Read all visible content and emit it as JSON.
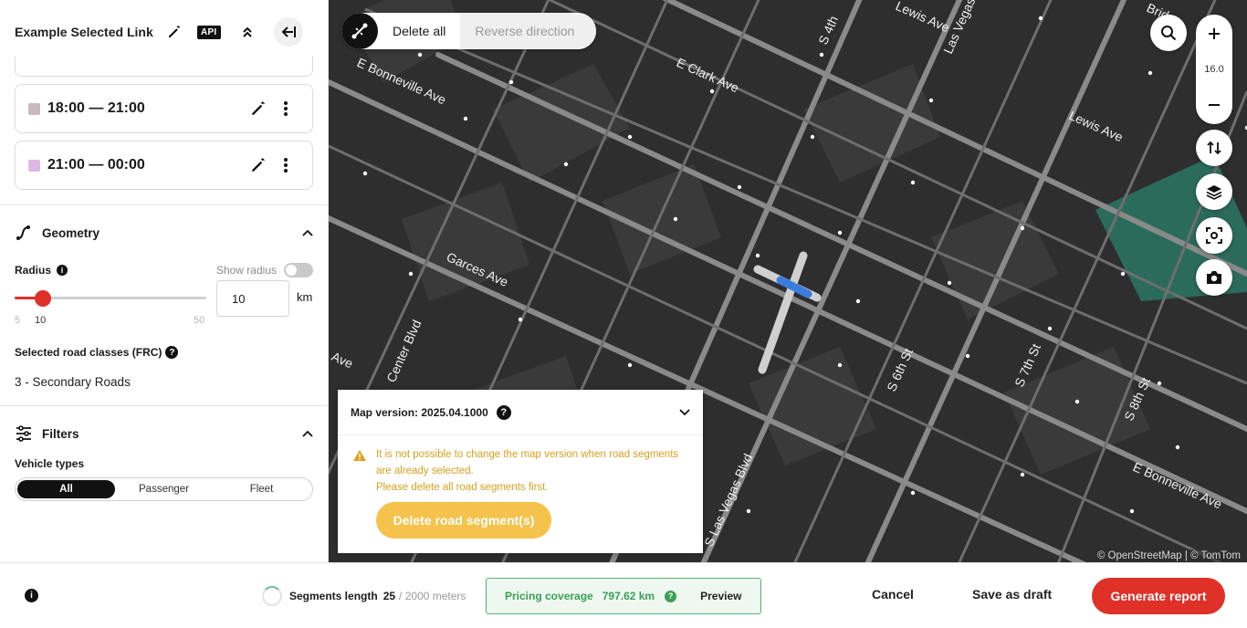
{
  "sidebar": {
    "title": "Example Selected Link",
    "api_label": "API",
    "time_slots": [
      {
        "label": "18:00 — 21:00",
        "color": "#c9b9bd"
      },
      {
        "label": "21:00 — 00:00",
        "color": "#ddb8e6"
      }
    ],
    "geometry": {
      "title": "Geometry",
      "radius_label": "Radius",
      "show_radius_label": "Show radius",
      "show_radius_on": false,
      "slider_min": "5",
      "slider_value": "10",
      "slider_max": "50",
      "radius_input": "10",
      "unit": "km",
      "road_classes_label": "Selected road classes (FRC)",
      "road_classes_value": "3 - Secondary Roads"
    },
    "filters": {
      "title": "Filters",
      "vehicle_types_label": "Vehicle types",
      "options": [
        "All",
        "Passenger",
        "Fleet"
      ],
      "selected": "All"
    }
  },
  "map": {
    "toolbar": {
      "delete_all": "Delete all",
      "reverse_direction": "Reverse direction"
    },
    "zoom_level": "16.0",
    "street_labels": [
      "E Bonneville Ave",
      "E Clark Ave",
      "Lewis Ave",
      "Lewis Ave",
      "Las Vegas",
      "S 4th",
      "Garces Ave",
      "Center Blvd",
      "Ave",
      "S 6th St",
      "S 7th St",
      "S 8th St",
      "E Bonneville Ave",
      "S Las Vegas Blvd",
      "Bridge"
    ],
    "attribution": "© OpenStreetMap | © TomTom",
    "map_version": {
      "label": "Map version: 2025.04.1000",
      "warning_lines": [
        "It is not possible to change the map version when road segments",
        "are already selected.",
        "Please delete all road segments first."
      ],
      "delete_button": "Delete road segment(s)"
    }
  },
  "footer": {
    "segments_length_label": "Segments length",
    "segments_length_value": "25",
    "segments_length_max": "/ 2000 meters",
    "pricing_label": "Pricing coverage",
    "pricing_value": "797.62 km",
    "preview": "Preview",
    "cancel": "Cancel",
    "save_draft": "Save as draft",
    "generate": "Generate report"
  },
  "colors": {
    "accent_red": "#df3127",
    "pricing_green": "#3aa055",
    "warning": "#e0a01a",
    "selection_blue": "#3b7ddd"
  },
  "icons": [
    "pencil-icon",
    "chevrons-up-icon",
    "collapse-left-icon",
    "more-vertical-icon",
    "geometry-icon",
    "chevron-up-icon",
    "info-icon",
    "question-icon",
    "sliders-icon",
    "search-icon",
    "plus-icon",
    "minus-icon",
    "sort-arrows-icon",
    "layers-icon",
    "focus-icon",
    "camera-icon",
    "warning-icon",
    "chevron-down-icon",
    "route-icon"
  ]
}
